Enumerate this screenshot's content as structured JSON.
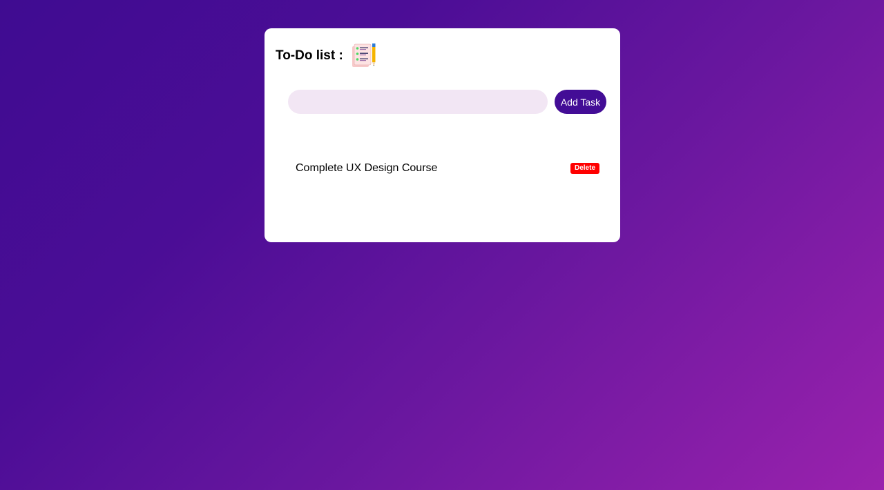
{
  "app": {
    "title": "To-Do list :",
    "title_icon": "checklist-notepad-pencil-icon"
  },
  "input": {
    "value": "",
    "placeholder": ""
  },
  "add_button": {
    "label": "Add Task"
  },
  "tasks": [
    {
      "text": "Complete UX Design Course",
      "delete_label": "Delete"
    }
  ],
  "colors": {
    "background_start": "#3f0c91",
    "background_end": "#9a22ad",
    "card": "#ffffff",
    "input_bg": "#f2e6f4",
    "add_button_bg": "#430d96",
    "delete_button_bg": "#ff0000"
  }
}
